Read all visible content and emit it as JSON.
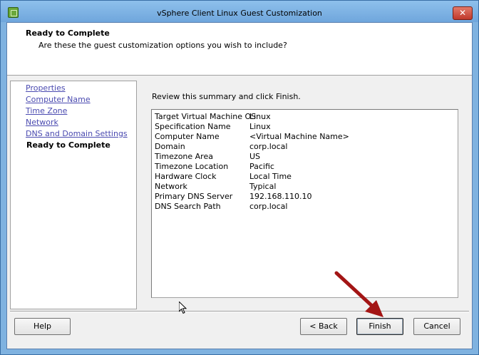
{
  "window": {
    "title": "vSphere Client Linux Guest Customization",
    "close_glyph": "✕"
  },
  "header": {
    "title": "Ready to Complete",
    "subtitle": "Are these the guest customization options you wish to include?"
  },
  "nav": {
    "items": [
      {
        "label": "Properties"
      },
      {
        "label": "Computer Name"
      },
      {
        "label": "Time Zone"
      },
      {
        "label": "Network"
      },
      {
        "label": "DNS and Domain Settings"
      }
    ],
    "current": "Ready to Complete"
  },
  "main": {
    "review_label": "Review this summary and click Finish.",
    "summary": [
      {
        "key": "Target Virtual Machine OS",
        "value": "Linux"
      },
      {
        "key": "Specification Name",
        "value": "Linux"
      },
      {
        "key": "Computer Name",
        "value": "<Virtual Machine Name>"
      },
      {
        "key": "Domain",
        "value": "corp.local"
      },
      {
        "key": "Timezone Area",
        "value": "US"
      },
      {
        "key": "Timezone Location",
        "value": "Pacific"
      },
      {
        "key": "Hardware Clock",
        "value": "Local Time"
      },
      {
        "key": "Network",
        "value": "Typical"
      },
      {
        "key": "Primary DNS Server",
        "value": "192.168.110.10"
      },
      {
        "key": "DNS Search Path",
        "value": "corp.local"
      }
    ]
  },
  "buttons": {
    "help": "Help",
    "back": "< Back",
    "finish": "Finish",
    "cancel": "Cancel"
  },
  "colors": {
    "titlebar": "#7fb2e0",
    "link": "#4a4ab0",
    "annotation_arrow": "#a31515",
    "close_button": "#c0392b"
  },
  "icons": {
    "app": "vsphere-app-icon",
    "close": "close-icon",
    "annotation": "red-arrow-icon",
    "cursor": "mouse-pointer-icon"
  }
}
